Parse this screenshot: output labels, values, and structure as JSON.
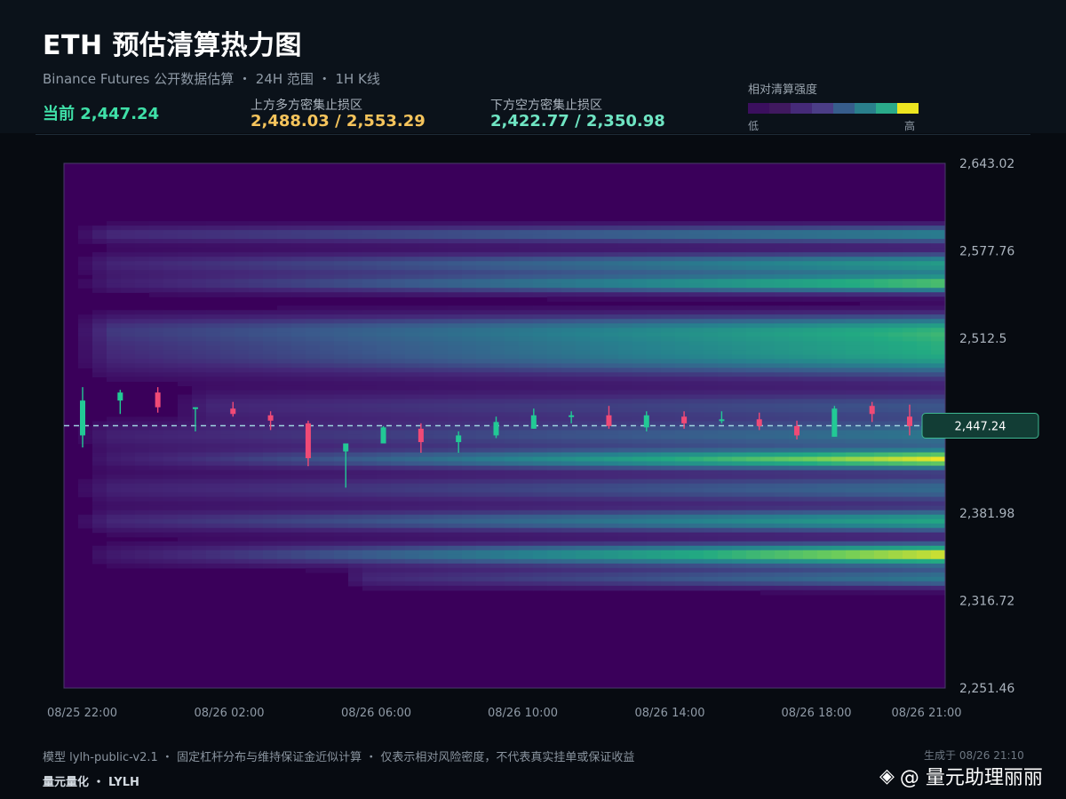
{
  "header": {
    "title": "ETH 预估清算热力图",
    "subtitle": "Binance Futures 公开数据估算 ・ 24H 范围 ・ 1H K线",
    "current_label": "当前 2,447.24",
    "upper_zone_label": "上方多方密集止损区",
    "upper_zone_value": "2,488.03 / 2,553.29",
    "lower_zone_label": "下方空方密集止损区",
    "lower_zone_value": "2,422.77 / 2,350.98"
  },
  "legend": {
    "title": "相对清算强度",
    "low": "低",
    "high": "高",
    "colors": [
      "#3b0f5e",
      "#40195f",
      "#452a78",
      "#4b3d86",
      "#375d8c",
      "#2a7f8c",
      "#2aaa8a",
      "#ede520"
    ]
  },
  "colors": {
    "up_candle": "#22c995",
    "down_candle": "#f04a76",
    "price_line": "#9fd3e0",
    "badge_bg": "#123d35",
    "badge_border": "#3fb892",
    "plot_bg": "#3a005a"
  },
  "chart_data": {
    "type": "heatmap",
    "x_tick_labels": [
      "08/25 22:00",
      "08/26 02:00",
      "08/26 06:00",
      "08/26 10:00",
      "08/26 14:00",
      "08/26 18:00",
      "08/26 21:00"
    ],
    "y_tick_labels": [
      "2,643.02",
      "2,577.76",
      "2,512.5",
      "2,381.98",
      "2,316.72",
      "2,251.46"
    ],
    "ylim": [
      2251.46,
      2643.02
    ],
    "current_price": 2447.24,
    "current_price_label": "2,447.24",
    "bands": [
      {
        "center": 2590,
        "width": 5,
        "start": 0.5,
        "peak": 0.55,
        "ramp": 0.35
      },
      {
        "center": 2568,
        "width": 6,
        "start": 0.5,
        "peak": 0.65,
        "ramp": 0.25
      },
      {
        "center": 2553,
        "width": 5,
        "start": 0.5,
        "peak": 0.8,
        "ramp": 0.15
      },
      {
        "center": 2520,
        "width": 8,
        "start": 0.5,
        "peak": 0.55,
        "ramp": 0.35
      },
      {
        "center": 2500,
        "width": 12,
        "start": 0.5,
        "peak": 0.7,
        "ramp": 0.25
      },
      {
        "center": 2462,
        "width": 8,
        "start": 3.0,
        "peak": 0.35,
        "ramp": 0.5
      },
      {
        "center": 2440,
        "width": 8,
        "start": 0.5,
        "peak": 0.5,
        "ramp": 0.3
      },
      {
        "center": 2422,
        "width": 5,
        "start": 0.5,
        "peak": 0.95,
        "ramp": 0.1
      },
      {
        "center": 2400,
        "width": 8,
        "start": 0.5,
        "peak": 0.45,
        "ramp": 0.35
      },
      {
        "center": 2376,
        "width": 6,
        "start": 0.5,
        "peak": 0.7,
        "ramp": 0.25
      },
      {
        "center": 2351,
        "width": 6,
        "start": 0.5,
        "peak": 1.0,
        "ramp": 0.1
      },
      {
        "center": 2333,
        "width": 5,
        "start": 7.0,
        "peak": 0.5,
        "ramp": 0.35
      }
    ],
    "candles": [
      {
        "t": 0,
        "o": 2440,
        "h": 2476,
        "l": 2431,
        "c": 2466
      },
      {
        "t": 1,
        "o": 2466,
        "h": 2474,
        "l": 2456,
        "c": 2472
      },
      {
        "t": 2,
        "o": 2472,
        "h": 2476,
        "l": 2457,
        "c": 2461
      },
      {
        "t": 3,
        "o": 2461,
        "h": 2461,
        "l": 2443,
        "c": 2461
      },
      {
        "t": 4,
        "o": 2460,
        "h": 2465,
        "l": 2454,
        "c": 2456
      },
      {
        "t": 5,
        "o": 2455,
        "h": 2458,
        "l": 2444,
        "c": 2451
      },
      {
        "t": 6,
        "o": 2449,
        "h": 2451,
        "l": 2417,
        "c": 2423
      },
      {
        "t": 7,
        "o": 2428,
        "h": 2433,
        "l": 2401,
        "c": 2434
      },
      {
        "t": 8,
        "o": 2434,
        "h": 2447,
        "l": 2434,
        "c": 2446
      },
      {
        "t": 9,
        "o": 2445,
        "h": 2449,
        "l": 2427,
        "c": 2435
      },
      {
        "t": 10,
        "o": 2435,
        "h": 2443,
        "l": 2427,
        "c": 2440
      },
      {
        "t": 11,
        "o": 2440,
        "h": 2454,
        "l": 2438,
        "c": 2450
      },
      {
        "t": 12,
        "o": 2445,
        "h": 2460,
        "l": 2445,
        "c": 2455
      },
      {
        "t": 13,
        "o": 2455,
        "h": 2458,
        "l": 2449,
        "c": 2455
      },
      {
        "t": 14,
        "o": 2455,
        "h": 2462,
        "l": 2445,
        "c": 2447
      },
      {
        "t": 15,
        "o": 2446,
        "h": 2458,
        "l": 2443,
        "c": 2455
      },
      {
        "t": 16,
        "o": 2454,
        "h": 2458,
        "l": 2445,
        "c": 2449
      },
      {
        "t": 17,
        "o": 2451,
        "h": 2458,
        "l": 2449,
        "c": 2452
      },
      {
        "t": 18,
        "o": 2452,
        "h": 2457,
        "l": 2444,
        "c": 2447
      },
      {
        "t": 19,
        "o": 2447,
        "h": 2451,
        "l": 2437,
        "c": 2440
      },
      {
        "t": 20,
        "o": 2439,
        "h": 2462,
        "l": 2439,
        "c": 2460
      },
      {
        "t": 21,
        "o": 2462,
        "h": 2465,
        "l": 2450,
        "c": 2456
      },
      {
        "t": 22,
        "o": 2454,
        "h": 2463,
        "l": 2440,
        "c": 2447
      }
    ]
  },
  "footer": {
    "note": "模型 lylh-public-v2.1 ・ 固定杠杆分布与维持保证金近似计算 ・ 仅表示相对风险密度，不代表真实挂单或保证收益",
    "brand": "量元量化 ・ LYLH",
    "generated": "生成于 08/26 21:10",
    "watermark": "@ 量元助理丽丽"
  }
}
